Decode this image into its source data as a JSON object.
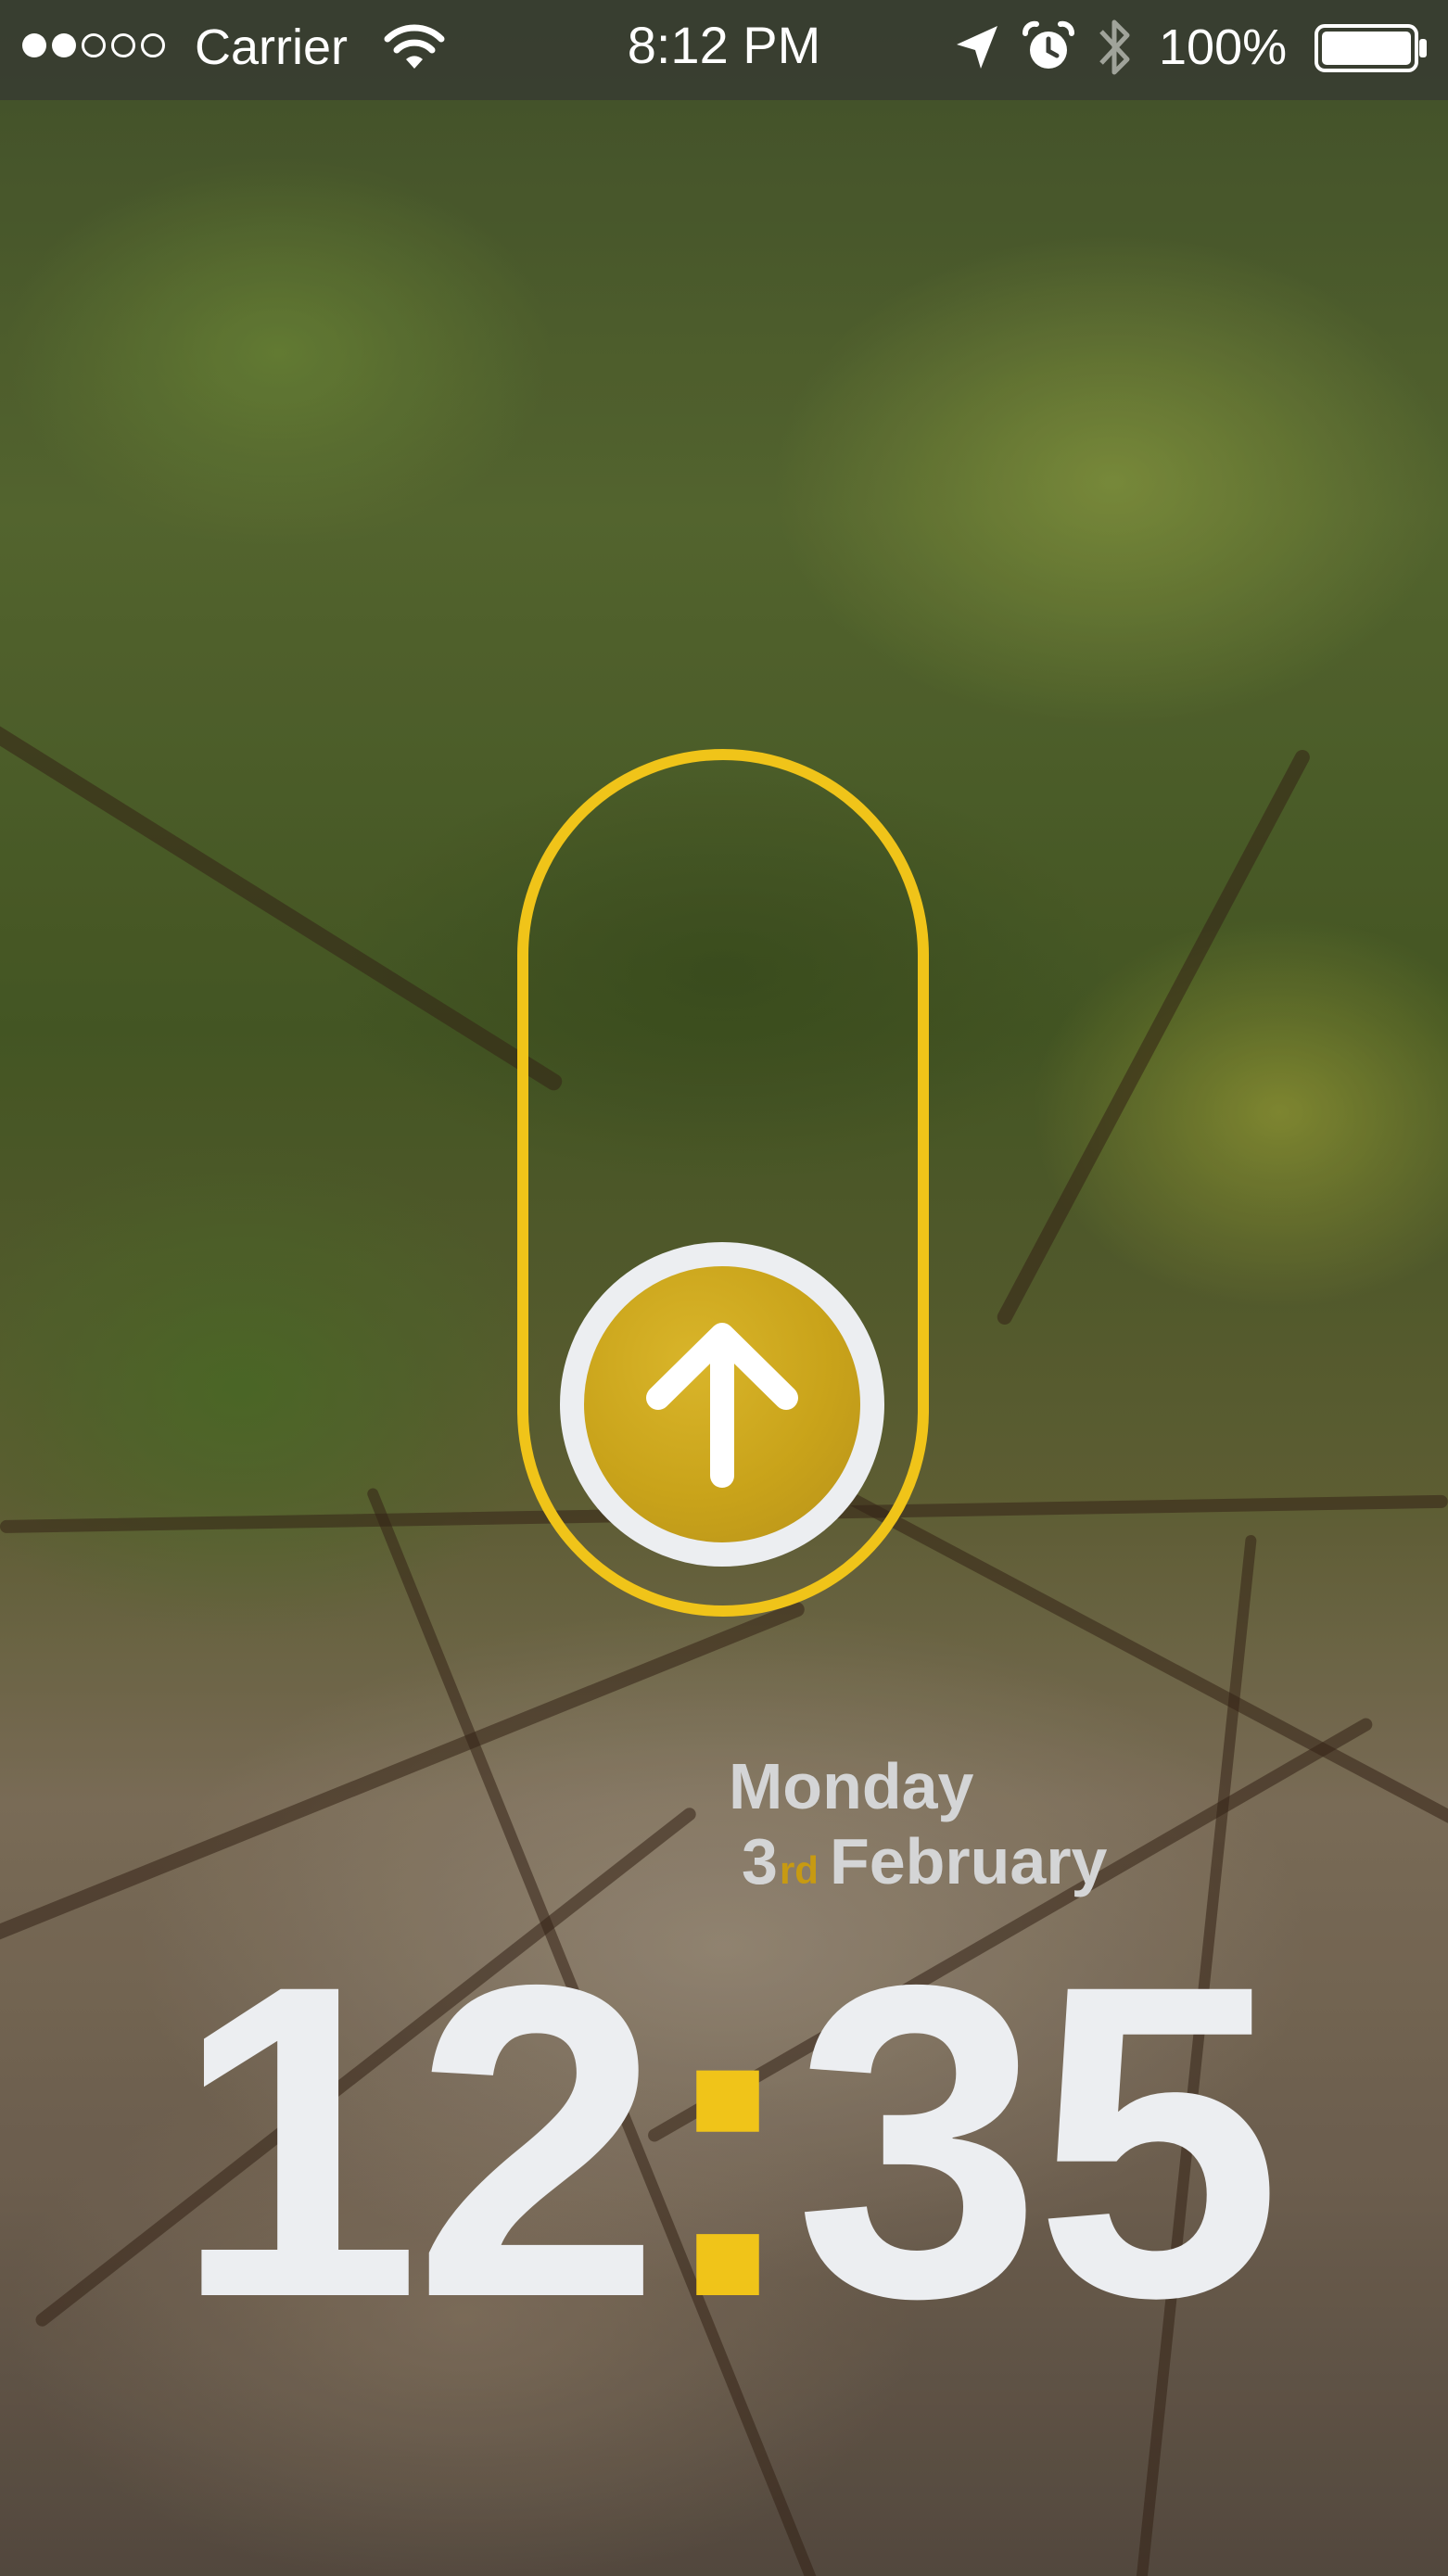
{
  "status_bar": {
    "carrier": "Carrier",
    "time": "8:12 PM",
    "battery_percent": "100%",
    "signal_strength_filled": 2,
    "signal_strength_total": 5,
    "battery_level": 1.0,
    "icons": [
      "wifi-icon",
      "location-icon",
      "alarm-icon",
      "bluetooth-icon",
      "battery-icon"
    ]
  },
  "unlock": {
    "icon": "arrow-up-icon",
    "accent_color": "#f0c419",
    "handle_color": "#c9a31a"
  },
  "date": {
    "weekday": "Monday",
    "day": "3",
    "day_suffix": "rd",
    "month": "February"
  },
  "clock": {
    "hours": "12",
    "separator": ":",
    "minutes": "35"
  },
  "colors": {
    "accent": "#f0c419",
    "text_light": "#eceef1",
    "date_text": "#d4d5d6"
  }
}
